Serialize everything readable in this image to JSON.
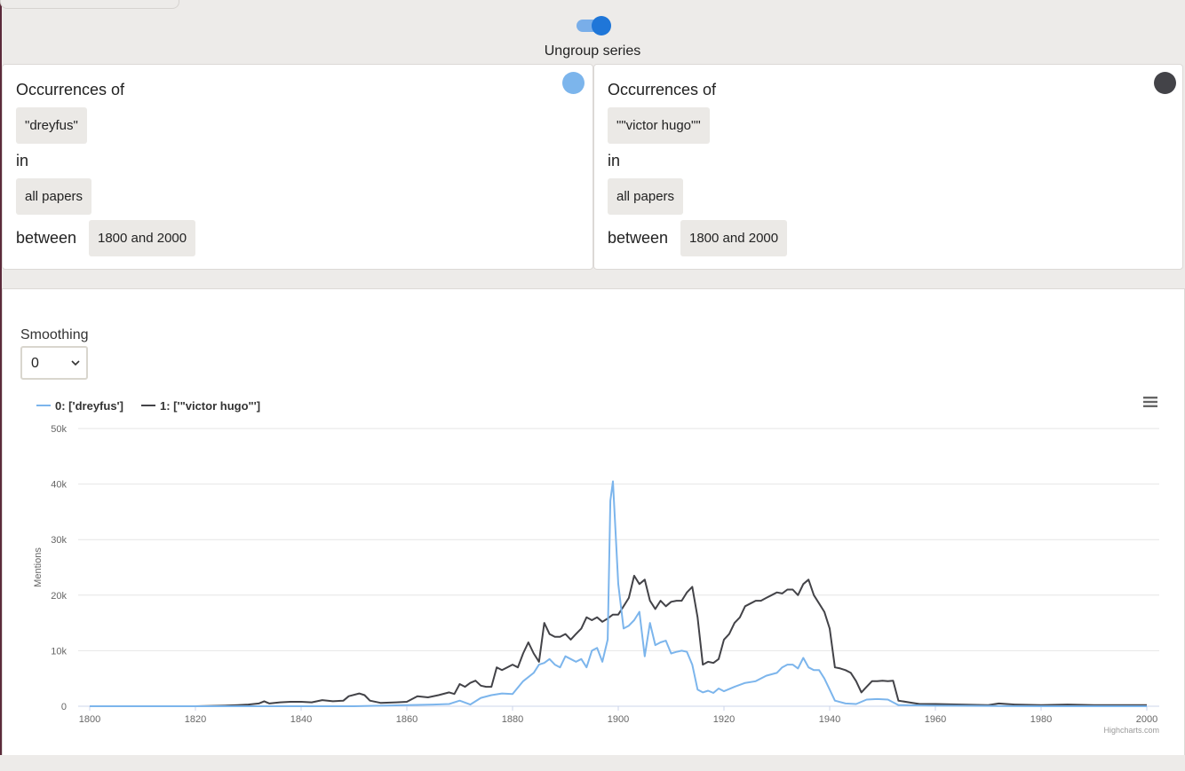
{
  "toggle": {
    "label": "Ungroup series",
    "on": true
  },
  "cards": [
    {
      "t1": "Occurrences of",
      "query": "\"dreyfus\"",
      "t2": "in",
      "source": "all papers",
      "t3": "between",
      "range": "1800 and 2000",
      "color": "#7cb5ec"
    },
    {
      "t1": "Occurrences of",
      "query": "\"\"victor hugo\"\"",
      "t2": "in",
      "source": "all papers",
      "t3": "between",
      "range": "1800 and 2000",
      "color": "#434348"
    }
  ],
  "smoothing": {
    "label": "Smoothing",
    "value": "0"
  },
  "icons": {
    "menu": "hamburger-menu-icon",
    "select": "chevron-down-icon"
  },
  "chart_data": {
    "type": "line",
    "ylabel": "Mentions",
    "xlim": [
      1800,
      2000
    ],
    "ylim": [
      0,
      50000
    ],
    "x_ticks": [
      "1800",
      "1820",
      "1840",
      "1860",
      "1880",
      "1900",
      "1920",
      "1940",
      "1960",
      "1980",
      "2000"
    ],
    "y_ticks": [
      "0",
      "10k",
      "20k",
      "30k",
      "40k",
      "50k"
    ],
    "legend_position": "top-left",
    "grid": true,
    "credits": "Highcharts.com",
    "series": [
      {
        "name": "0: ['dreyfus']",
        "color": "#7cb5ec",
        "points": [
          [
            1800,
            0
          ],
          [
            1820,
            0
          ],
          [
            1840,
            0
          ],
          [
            1850,
            0
          ],
          [
            1860,
            200
          ],
          [
            1865,
            300
          ],
          [
            1868,
            400
          ],
          [
            1870,
            1000
          ],
          [
            1872,
            300
          ],
          [
            1874,
            1500
          ],
          [
            1876,
            2000
          ],
          [
            1878,
            2300
          ],
          [
            1880,
            2200
          ],
          [
            1882,
            4500
          ],
          [
            1884,
            6000
          ],
          [
            1885,
            7500
          ],
          [
            1886,
            7800
          ],
          [
            1887,
            8500
          ],
          [
            1888,
            7500
          ],
          [
            1889,
            7000
          ],
          [
            1890,
            9000
          ],
          [
            1891,
            8500
          ],
          [
            1892,
            8000
          ],
          [
            1893,
            8500
          ],
          [
            1894,
            7000
          ],
          [
            1895,
            10000
          ],
          [
            1896,
            10500
          ],
          [
            1897,
            8000
          ],
          [
            1898,
            12000
          ],
          [
            1898.5,
            37000
          ],
          [
            1899,
            40500
          ],
          [
            1900,
            22000
          ],
          [
            1901,
            14000
          ],
          [
            1902,
            14500
          ],
          [
            1903,
            15500
          ],
          [
            1904,
            17000
          ],
          [
            1905,
            9000
          ],
          [
            1906,
            15000
          ],
          [
            1907,
            11000
          ],
          [
            1908,
            11500
          ],
          [
            1909,
            11800
          ],
          [
            1910,
            9500
          ],
          [
            1911,
            9800
          ],
          [
            1912,
            10000
          ],
          [
            1913,
            9800
          ],
          [
            1914,
            7500
          ],
          [
            1915,
            3000
          ],
          [
            1916,
            2500
          ],
          [
            1917,
            2800
          ],
          [
            1918,
            2400
          ],
          [
            1919,
            3200
          ],
          [
            1920,
            2700
          ],
          [
            1922,
            3500
          ],
          [
            1924,
            4200
          ],
          [
            1926,
            4500
          ],
          [
            1928,
            5500
          ],
          [
            1930,
            6000
          ],
          [
            1931,
            7000
          ],
          [
            1932,
            7500
          ],
          [
            1933,
            7500
          ],
          [
            1934,
            6800
          ],
          [
            1935,
            8700
          ],
          [
            1936,
            7000
          ],
          [
            1937,
            6500
          ],
          [
            1938,
            6500
          ],
          [
            1939,
            5000
          ],
          [
            1940,
            3000
          ],
          [
            1941,
            1000
          ],
          [
            1943,
            500
          ],
          [
            1945,
            400
          ],
          [
            1947,
            1200
          ],
          [
            1949,
            1300
          ],
          [
            1951,
            1200
          ],
          [
            1953,
            200
          ],
          [
            1960,
            100
          ],
          [
            1980,
            0
          ],
          [
            2000,
            0
          ]
        ]
      },
      {
        "name": "1: ['\"victor hugo\"']",
        "color": "#434348",
        "points": [
          [
            1800,
            0
          ],
          [
            1820,
            0
          ],
          [
            1825,
            100
          ],
          [
            1828,
            200
          ],
          [
            1830,
            300
          ],
          [
            1832,
            500
          ],
          [
            1833,
            900
          ],
          [
            1834,
            500
          ],
          [
            1836,
            700
          ],
          [
            1838,
            800
          ],
          [
            1840,
            800
          ],
          [
            1842,
            700
          ],
          [
            1844,
            1100
          ],
          [
            1846,
            900
          ],
          [
            1848,
            1000
          ],
          [
            1849,
            1800
          ],
          [
            1851,
            2300
          ],
          [
            1852,
            2000
          ],
          [
            1853,
            1000
          ],
          [
            1855,
            600
          ],
          [
            1858,
            700
          ],
          [
            1860,
            800
          ],
          [
            1862,
            1800
          ],
          [
            1864,
            1600
          ],
          [
            1866,
            2000
          ],
          [
            1868,
            2500
          ],
          [
            1869,
            2200
          ],
          [
            1870,
            4000
          ],
          [
            1871,
            3500
          ],
          [
            1872,
            4200
          ],
          [
            1873,
            4600
          ],
          [
            1874,
            3700
          ],
          [
            1875,
            3500
          ],
          [
            1876,
            3500
          ],
          [
            1877,
            7000
          ],
          [
            1878,
            6500
          ],
          [
            1879,
            7000
          ],
          [
            1880,
            7500
          ],
          [
            1881,
            7000
          ],
          [
            1882,
            9500
          ],
          [
            1883,
            11500
          ],
          [
            1884,
            9500
          ],
          [
            1885,
            8000
          ],
          [
            1886,
            15000
          ],
          [
            1887,
            13000
          ],
          [
            1888,
            12500
          ],
          [
            1889,
            12500
          ],
          [
            1890,
            13000
          ],
          [
            1891,
            12000
          ],
          [
            1892,
            13000
          ],
          [
            1893,
            14000
          ],
          [
            1894,
            16000
          ],
          [
            1895,
            15500
          ],
          [
            1896,
            16000
          ],
          [
            1897,
            15200
          ],
          [
            1898,
            15800
          ],
          [
            1899,
            16500
          ],
          [
            1900,
            16500
          ],
          [
            1901,
            18000
          ],
          [
            1902,
            19500
          ],
          [
            1903,
            23500
          ],
          [
            1904,
            22000
          ],
          [
            1905,
            22800
          ],
          [
            1906,
            19000
          ],
          [
            1907,
            17500
          ],
          [
            1908,
            19000
          ],
          [
            1909,
            18000
          ],
          [
            1910,
            18800
          ],
          [
            1911,
            19000
          ],
          [
            1912,
            19000
          ],
          [
            1913,
            20500
          ],
          [
            1914,
            21500
          ],
          [
            1915,
            16000
          ],
          [
            1916,
            7500
          ],
          [
            1917,
            8000
          ],
          [
            1918,
            7800
          ],
          [
            1919,
            8500
          ],
          [
            1920,
            12000
          ],
          [
            1921,
            13000
          ],
          [
            1922,
            15000
          ],
          [
            1923,
            16000
          ],
          [
            1924,
            18000
          ],
          [
            1925,
            18500
          ],
          [
            1926,
            19000
          ],
          [
            1927,
            19000
          ],
          [
            1928,
            19500
          ],
          [
            1929,
            20000
          ],
          [
            1930,
            20500
          ],
          [
            1931,
            20300
          ],
          [
            1932,
            21000
          ],
          [
            1933,
            21000
          ],
          [
            1934,
            20000
          ],
          [
            1935,
            22000
          ],
          [
            1936,
            22800
          ],
          [
            1937,
            20000
          ],
          [
            1938,
            18500
          ],
          [
            1939,
            17000
          ],
          [
            1940,
            14000
          ],
          [
            1941,
            7000
          ],
          [
            1942,
            6800
          ],
          [
            1943,
            6500
          ],
          [
            1944,
            6000
          ],
          [
            1945,
            4500
          ],
          [
            1946,
            2500
          ],
          [
            1947,
            3500
          ],
          [
            1948,
            4500
          ],
          [
            1949,
            4500
          ],
          [
            1950,
            4600
          ],
          [
            1951,
            4500
          ],
          [
            1952,
            4600
          ],
          [
            1953,
            1000
          ],
          [
            1955,
            700
          ],
          [
            1957,
            400
          ],
          [
            1960,
            400
          ],
          [
            1965,
            300
          ],
          [
            1970,
            200
          ],
          [
            1972,
            500
          ],
          [
            1975,
            300
          ],
          [
            1980,
            200
          ],
          [
            1985,
            300
          ],
          [
            1990,
            200
          ],
          [
            2000,
            200
          ]
        ]
      }
    ]
  }
}
